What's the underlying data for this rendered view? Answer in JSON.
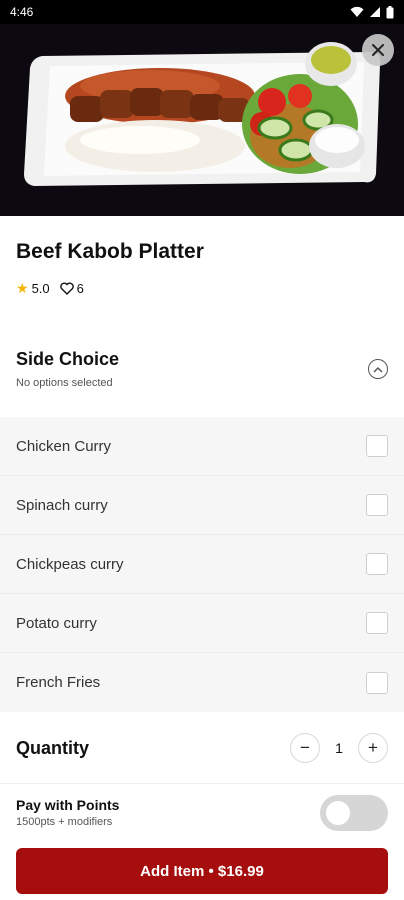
{
  "status_bar": {
    "time": "4:46",
    "icons": [
      "wifi-icon",
      "signal-icon",
      "battery-icon"
    ]
  },
  "item": {
    "title": "Beef Kabob Platter",
    "rating": "5.0",
    "likes": "6"
  },
  "side_choice": {
    "title": "Side Choice",
    "subtitle": "No options selected",
    "options": [
      {
        "label": "Chicken Curry",
        "checked": false
      },
      {
        "label": "Spinach curry",
        "checked": false
      },
      {
        "label": "Chickpeas curry",
        "checked": false
      },
      {
        "label": "Potato curry",
        "checked": false
      },
      {
        "label": "French Fries",
        "checked": false
      }
    ]
  },
  "quantity": {
    "label": "Quantity",
    "value": "1",
    "decrement": "−",
    "increment": "+"
  },
  "points": {
    "title": "Pay with Points",
    "subtitle": "1500pts + modifiers",
    "enabled": false
  },
  "cta": {
    "label": "Add Item • $16.99"
  },
  "colors": {
    "brand": "#a60e0e",
    "star": "#f4b400",
    "toggle_off": "#d6d6d6"
  }
}
